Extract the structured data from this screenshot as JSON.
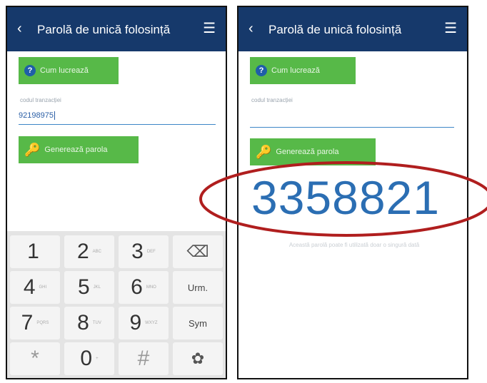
{
  "left_screen": {
    "header": {
      "back_icon": "‹",
      "title": "Parolă de unică folosință",
      "menu_icon": "☰"
    },
    "help_button": {
      "icon": "?",
      "label": "Cum lucrează"
    },
    "field": {
      "label": "codul tranzacției",
      "value": "92198975"
    },
    "generate_button": {
      "label": "Generează parola"
    },
    "keypad": {
      "keys": [
        {
          "digit": "1",
          "sub": ""
        },
        {
          "digit": "2",
          "sub": "ABC"
        },
        {
          "digit": "3",
          "sub": "DEF"
        },
        {
          "digit": "4",
          "sub": "GHI"
        },
        {
          "digit": "5",
          "sub": "JKL"
        },
        {
          "digit": "6",
          "sub": "MNO"
        },
        {
          "digit": "7",
          "sub": "PQRS"
        },
        {
          "digit": "8",
          "sub": "TUV"
        },
        {
          "digit": "9",
          "sub": "WXYZ"
        },
        {
          "digit": "*",
          "sub": ""
        },
        {
          "digit": "0",
          "sub": "+"
        },
        {
          "digit": "#",
          "sub": ""
        }
      ],
      "backspace_icon": "⌫",
      "next_label": "Urm.",
      "sym_label": "Sym",
      "settings_icon": "✿"
    }
  },
  "right_screen": {
    "header": {
      "back_icon": "‹",
      "title": "Parolă de unică folosință",
      "menu_icon": "☰"
    },
    "help_button": {
      "icon": "?",
      "label": "Cum lucrează"
    },
    "field": {
      "label": "codul tranzacției",
      "value": ""
    },
    "generate_button": {
      "label": "Generează parola"
    },
    "password": "3358821",
    "hint": "Această parolă poate fi utilizată doar o singură dată"
  },
  "colors": {
    "header": "#16396b",
    "button": "#57b948",
    "accent": "#2b6eb3",
    "highlight_ring": "#b01e1e"
  }
}
